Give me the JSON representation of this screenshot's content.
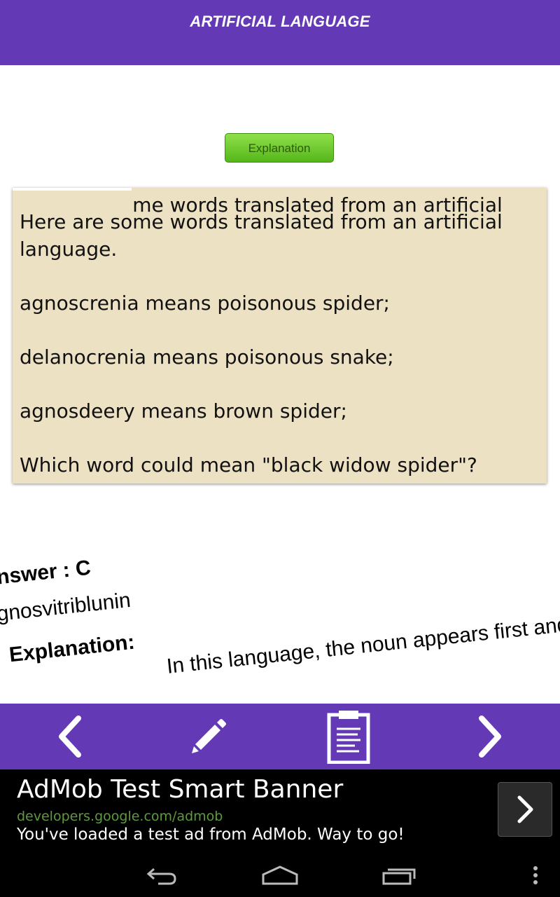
{
  "app": {
    "title": "ARTIFICIAL LANGUAGE"
  },
  "explanation_button": {
    "label": "Explanation"
  },
  "question": {
    "ghost_text": "Here are some words translated from an artificial",
    "text": "Here are some words translated from an artificial language.\n\nagnoscrenia means poisonous spider;\n\ndelanocrenia means poisonous snake;\n\nagnosdeery means brown spider;\n\nWhich word could mean \"black widow spider\"?"
  },
  "answer": {
    "label": "Answer : C",
    "value": "agnosvitriblunin",
    "explanation_label": "Explanation:",
    "explanation_text": "In this language, the noun appears first and the"
  },
  "bottom_bar": {
    "icons": [
      "chevron-left-icon",
      "pencil-icon",
      "clipboard-icon",
      "chevron-right-icon"
    ]
  },
  "ad": {
    "title": "AdMob Test Smart Banner",
    "url": "developers.google.com/admob",
    "description": "You've loaded a test ad from AdMob. Way to go!"
  },
  "system_nav": {
    "icons": [
      "back-icon",
      "home-icon",
      "recents-icon",
      "overflow-menu-icon"
    ]
  },
  "colors": {
    "primary": "#6339b5",
    "card": "#ede1c4",
    "button_green": "#6fcb2c"
  }
}
